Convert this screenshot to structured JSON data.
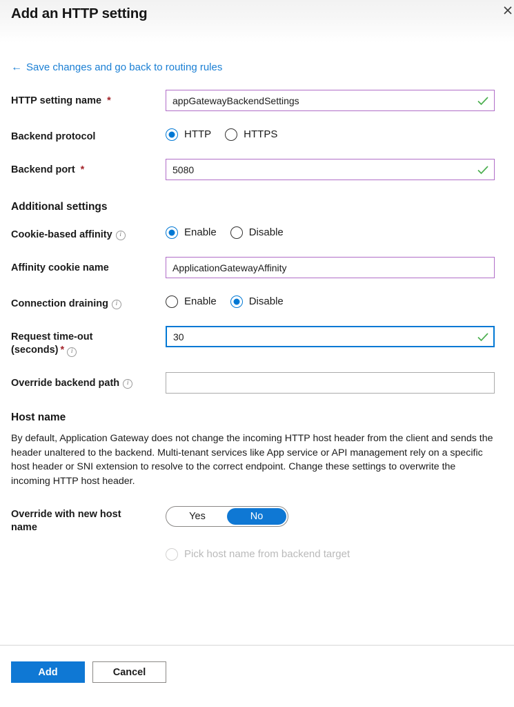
{
  "blade": {
    "title": "Add an HTTP setting",
    "close_icon": "close-icon",
    "back_link": {
      "arrow": "←",
      "label": "Save changes and go back to routing rules"
    }
  },
  "form": {
    "http_setting_name": {
      "label": "HTTP setting name",
      "required": "*",
      "value": "appGatewayBackendSettings",
      "placeholder": "",
      "valid": true,
      "border_color": "#b06dc8"
    },
    "backend_protocol": {
      "label": "Backend protocol",
      "options": [
        "HTTP",
        "HTTPS"
      ],
      "selected": "HTTP"
    },
    "backend_port": {
      "label": "Backend port",
      "required": "*",
      "value": "5080",
      "placeholder": "",
      "valid": true,
      "border_color": "#b06dc8"
    }
  },
  "additional_settings": {
    "heading": "Additional settings",
    "cookie_affinity": {
      "label": "Cookie-based affinity",
      "info": "info-icon",
      "options": [
        "Enable",
        "Disable"
      ],
      "selected": "Enable"
    },
    "affinity_cookie_name": {
      "label": "Affinity cookie name",
      "value": "ApplicationGatewayAffinity",
      "placeholder": "",
      "valid": false,
      "border_color": "#b06dc8"
    },
    "connection_draining": {
      "label": "Connection draining",
      "info": "info-icon",
      "options": [
        "Enable",
        "Disable"
      ],
      "selected": "Disable"
    },
    "request_timeout": {
      "label_line1": "Request time-out",
      "label_line2": "(seconds)",
      "required": "*",
      "info": "info-icon",
      "value": "30",
      "placeholder": "",
      "valid": true,
      "focused": true,
      "border_color": "#0078d4"
    },
    "override_backend_path": {
      "label": "Override backend path",
      "info": "info-icon",
      "value": "",
      "placeholder": "",
      "valid": false,
      "border_color": "#aaaaaa"
    }
  },
  "host_name": {
    "heading": "Host name",
    "description": "By default, Application Gateway does not change the incoming HTTP host header from the client and sends the header unaltered to the backend. Multi-tenant services like App service or API management rely on a specific host header or SNI extension to resolve to the correct endpoint. Change these settings to overwrite the incoming HTTP host header.",
    "override_with_new_host_name": {
      "label_line1": "Override with new host",
      "label_line2": "name",
      "options": [
        "Yes",
        "No"
      ],
      "selected": "No"
    },
    "pick_host_name": {
      "label": "Pick host name from backend target",
      "selected": false
    }
  },
  "footer": {
    "add_label": "Add",
    "cancel_label": "Cancel"
  },
  "colors": {
    "accent_blue": "#0f78d4",
    "link_blue": "#1a7fd4",
    "valid_green": "#4caf50",
    "required_red": "#a4262c",
    "input_purple": "#b06dc8",
    "input_gray": "#aaaaaa"
  }
}
